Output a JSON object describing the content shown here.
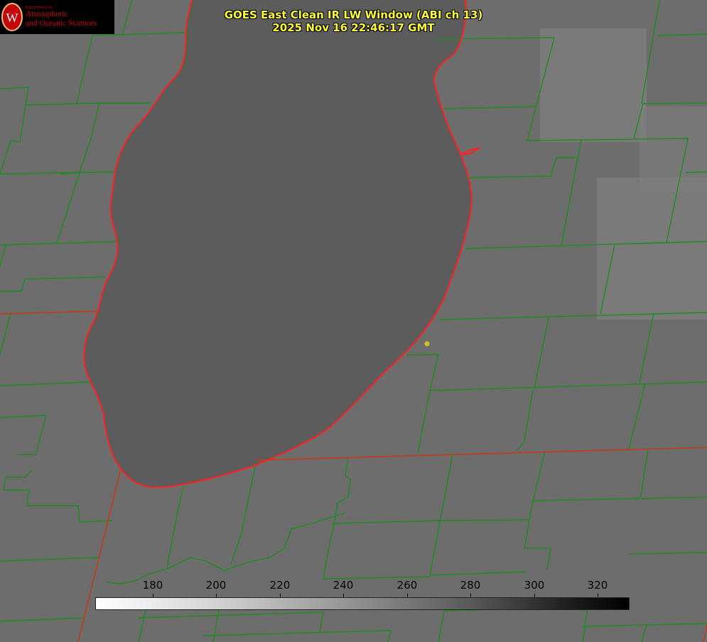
{
  "title": {
    "line1": "GOES East Clean IR LW Window (ABI ch 13)",
    "line2": "2025 Nov 16 22:46:17 GMT"
  },
  "logo": {
    "dept": "Department of",
    "line1": "Atmospheric",
    "line2": "and Oceanic Sciences",
    "icon": "uw-crest-icon"
  },
  "colorbar": {
    "ticks": [
      "180",
      "200",
      "220",
      "240",
      "260",
      "280",
      "300",
      "320"
    ],
    "gradient": "white-to-black"
  },
  "colors": {
    "county_lines": "#1f8c1f",
    "state_coast": "#ff2222",
    "title": "#ffff33",
    "marker": "#d9c021",
    "background": "#6d6d6d",
    "lake": "#5a5a5a"
  }
}
